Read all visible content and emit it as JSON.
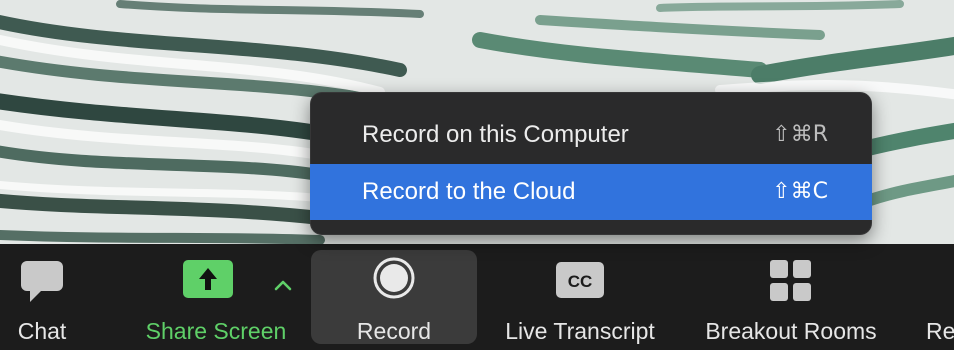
{
  "menu": {
    "items": [
      {
        "label": "Record on this Computer",
        "shortcut": "⇧⌘R",
        "selected": false
      },
      {
        "label": "Record to the Cloud",
        "shortcut": "⇧⌘C",
        "selected": true
      }
    ]
  },
  "toolbar": {
    "chat_label": "Chat",
    "share_label": "Share Screen",
    "record_label": "Record",
    "transcript_label": "Live Transcript",
    "cc_text": "CC",
    "breakout_label": "Breakout Rooms",
    "overflow_label": "Re"
  },
  "colors": {
    "menu_highlight": "#3173dd",
    "share_green": "#5fd068",
    "toolbar_bg": "#1c1c1c"
  },
  "icons": [
    "chat-bubble-icon",
    "share-screen-arrow-icon",
    "chevron-up-icon",
    "record-icon",
    "closed-caption-icon",
    "breakout-rooms-grid-icon"
  ]
}
